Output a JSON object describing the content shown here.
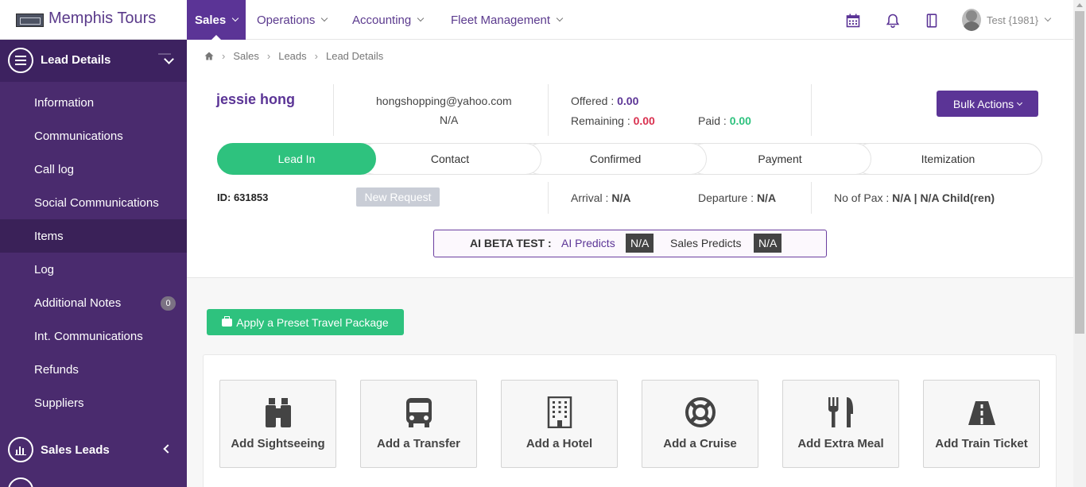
{
  "brand": {
    "name": "Memphis Tours"
  },
  "sidebar": {
    "section_title": "Lead Details",
    "items": [
      {
        "label": "Information"
      },
      {
        "label": "Communications"
      },
      {
        "label": "Call log"
      },
      {
        "label": "Social Communications"
      },
      {
        "label": "Items",
        "active": true
      },
      {
        "label": "Log"
      },
      {
        "label": "Additional Notes",
        "badge": "0"
      },
      {
        "label": "Int. Communications"
      },
      {
        "label": "Refunds"
      },
      {
        "label": "Suppliers"
      }
    ],
    "footer_section": "Sales Leads"
  },
  "topnav": {
    "items": [
      {
        "label": "Sales",
        "active": true
      },
      {
        "label": "Operations"
      },
      {
        "label": "Accounting"
      },
      {
        "label": "Fleet Management"
      }
    ],
    "icons": [
      "calendar-icon",
      "bell-icon",
      "notebook-icon"
    ],
    "user": "Test {1981}"
  },
  "breadcrumb": [
    "Sales",
    "Leads",
    "Lead Details"
  ],
  "lead": {
    "name": "jessie hong",
    "email": "hongshopping@yahoo.com",
    "phone": "N/A",
    "offered_label": "Offered :",
    "offered": "0.00",
    "remaining_label": "Remaining :",
    "remaining": "0.00",
    "paid_label": "Paid :",
    "paid": "0.00",
    "id": "ID: 631853",
    "status": "New Request",
    "arrival_label": "Arrival :",
    "arrival": "N/A",
    "departure_label": "Departure :",
    "departure": "N/A",
    "pax_label": "No of Pax :",
    "pax": "N/A | N/A Child(ren)"
  },
  "bulk_actions": "Bulk Actions",
  "steps": [
    "Lead In",
    "Contact",
    "Confirmed",
    "Payment",
    "Itemization"
  ],
  "ai": {
    "label": "AI BETA TEST :",
    "ai_predicts": "AI Predicts",
    "ai_value": "N/A",
    "sales_predicts": "Sales Predicts",
    "sales_value": "N/A"
  },
  "preset_button": "Apply a Preset Travel Package",
  "cards": [
    {
      "label": "Add Sightseeing",
      "icon": "binoculars-icon"
    },
    {
      "label": "Add a Transfer",
      "icon": "bus-icon"
    },
    {
      "label": "Add a Hotel",
      "icon": "building-icon"
    },
    {
      "label": "Add a Cruise",
      "icon": "life-ring-icon"
    },
    {
      "label": "Add Extra Meal",
      "icon": "cutlery-icon"
    },
    {
      "label": "Add Train Ticket",
      "icon": "road-icon"
    }
  ],
  "colors": {
    "sidebar": "#4a2b6e",
    "accent": "#5b3496",
    "green": "#2ec27e",
    "red": "#d9304f"
  }
}
